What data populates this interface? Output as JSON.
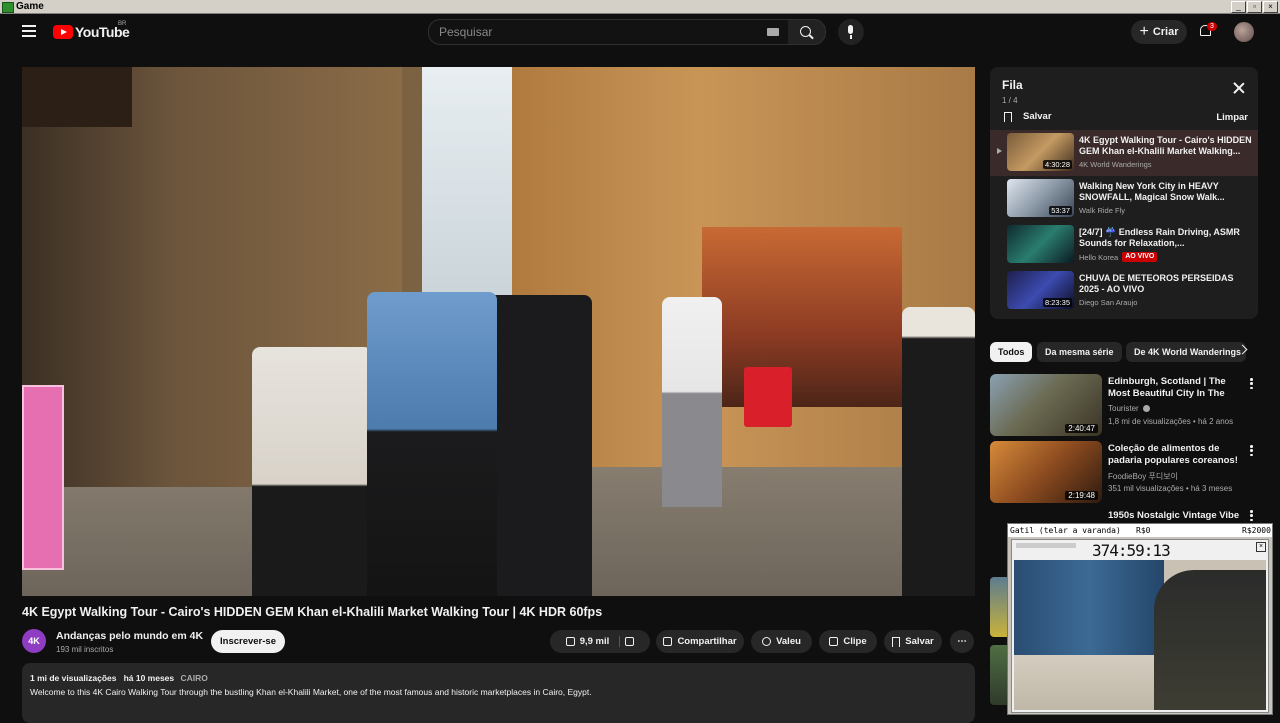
{
  "window": {
    "title": "Game",
    "controls": [
      "_",
      "▫",
      "×"
    ]
  },
  "header": {
    "logo_text": "YouTube",
    "logo_country": "BR",
    "search_placeholder": "Pesquisar",
    "create_label": "Criar",
    "notifications_count": "3"
  },
  "video": {
    "title": "4K Egypt Walking Tour - Cairo's HIDDEN GEM Khan el-Khalili Market Walking Tour | 4K HDR 60fps",
    "channel_avatar_text": "4K",
    "channel_name": "Andanças pelo mundo em 4K",
    "subscribers": "193 mil inscritos",
    "subscribe_label": "Inscrever-se",
    "likes": "9,9 mil",
    "share_label": "Compartilhar",
    "thanks_label": "Valeu",
    "clip_label": "Clipe",
    "save_label": "Salvar",
    "views": "1 mi de visualizações",
    "age": "há 10 meses",
    "location": "CAIRO",
    "description": "Welcome to this 4K Cairo Walking Tour through the bustling Khan el-Khalili Market, one of the most famous and historic marketplaces in Cairo, Egypt."
  },
  "queue": {
    "title": "Fila",
    "count": "1 / 4",
    "save_label": "Salvar",
    "clear_label": "Limpar",
    "items": [
      {
        "title": "4K Egypt Walking Tour - Cairo's HIDDEN GEM Khan el-Khalili Market Walking...",
        "channel": "4K World Wanderings",
        "duration": "4:30:28",
        "live": ""
      },
      {
        "title": "Walking New York City in HEAVY SNOWFALL, Magical Snow Walk...",
        "channel": "Walk Ride Fly",
        "duration": "53:37",
        "live": ""
      },
      {
        "title": "[24/7] ☔ Endless Rain Driving, ASMR Sounds for Relaxation,...",
        "channel": "Hello Korea",
        "duration": "",
        "live": "AO VIVO"
      },
      {
        "title": "CHUVA DE METEOROS PERSEIDAS 2025 - AO VIVO",
        "channel": "Diego San Araujo",
        "duration": "8:23:35",
        "live": ""
      }
    ]
  },
  "chips": [
    "Todos",
    "Da mesma série",
    "De 4K World Wanderings"
  ],
  "recommendations": [
    {
      "title": "Edinburgh, Scotland | The Most Beautiful City In The World | ...",
      "channel": "Tourister",
      "meta": "1,8 mi de visualizações • há 2 anos",
      "duration": "2:40:47"
    },
    {
      "title": "Coleção de alimentos de padaria populares coreanos!",
      "channel": "FoodieBoy 푸디보이",
      "meta": "351 mil visualizações • há 3 meses",
      "duration": "2:19:48"
    },
    {
      "title": "1950s Nostalgic Vintage Vibe",
      "channel": "",
      "meta": "",
      "duration": ""
    }
  ],
  "overlay": {
    "bar_label": "Gatil (telar a varanda)",
    "bar_mid": "R$0",
    "bar_right": "R$2000",
    "timer": "374:59:13"
  },
  "colors": {
    "accent": "#ff0000",
    "live": "#cc0000",
    "background": "#0f0f0f"
  }
}
